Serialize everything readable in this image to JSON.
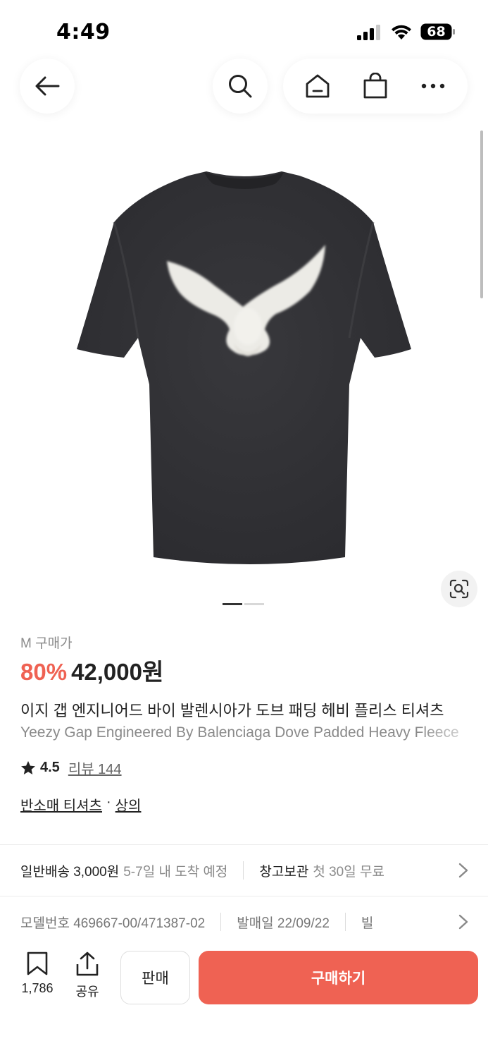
{
  "status_bar": {
    "time": "4:49",
    "battery": "68"
  },
  "nav": {
    "icons": [
      "back-arrow-icon",
      "search-icon",
      "home-icon",
      "shopping-bag-icon",
      "more-icon"
    ]
  },
  "product": {
    "size_label": "M 구매가",
    "discount": "80%",
    "price": "42,000원",
    "title_ko": "이지 갭 엔지니어드 바이 발렌시아가 도브 패딩 헤비 플리스 티셔츠",
    "title_en": "Yeezy Gap Engineered By Balenciaga Dove Padded Heavy Fleece",
    "rating": "4.5",
    "review_label": "리뷰 144",
    "category_1": "반소매 티셔츠",
    "category_sep": "·",
    "category_2": "상의",
    "image_pages": 2,
    "current_page": 1
  },
  "shipping": {
    "label": "일반배송 3,000원",
    "eta": "5-7일 내 도착 예정",
    "storage_label": "창고보관",
    "storage_detail": "첫 30일 무료"
  },
  "meta": {
    "model_label": "모델번호 469667-00/471387-02",
    "release_label": "발매일 22/09/22",
    "extra": "빌"
  },
  "bottom_bar": {
    "bookmark_count": "1,786",
    "share_label": "공유",
    "sell_label": "판매",
    "buy_label": "구매하기"
  },
  "colors": {
    "accent": "#ef6253",
    "shirt": "#3a3a3e"
  }
}
